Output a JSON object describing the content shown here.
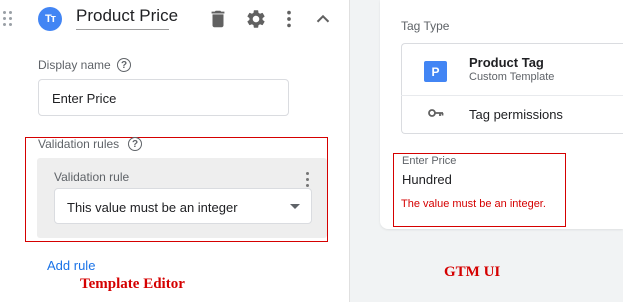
{
  "template_editor": {
    "badge_text": "Tт",
    "title": "Product Price",
    "display_name_label": "Display name",
    "display_name_value": "Enter Price",
    "validation_rules_label": "Validation rules",
    "validation_rule_label": "Validation rule",
    "validation_rule_selected": "This value must be an integer",
    "add_rule_label": "Add rule",
    "caption": "Template Editor",
    "help_glyph": "?"
  },
  "gtm_ui": {
    "tag_type_label": "Tag Type",
    "tag_badge": "P",
    "tag_name": "Product Tag",
    "tag_subtitle": "Custom Template",
    "permissions_label": "Tag permissions",
    "field_label": "Enter Price",
    "field_value": "Hundred",
    "error_message": "The value must be an integer.",
    "caption": "GTM UI"
  },
  "colors": {
    "accent_blue": "#4285f4",
    "link_blue": "#1a73e8",
    "annotation_red": "#d50000",
    "panel_gray": "#f1f3f4"
  },
  "icons": [
    "drag-handle-icon",
    "delete-icon",
    "settings-gear-icon",
    "more-vert-icon",
    "chevron-up-icon",
    "help-icon",
    "dropdown-arrow-icon",
    "key-icon"
  ]
}
